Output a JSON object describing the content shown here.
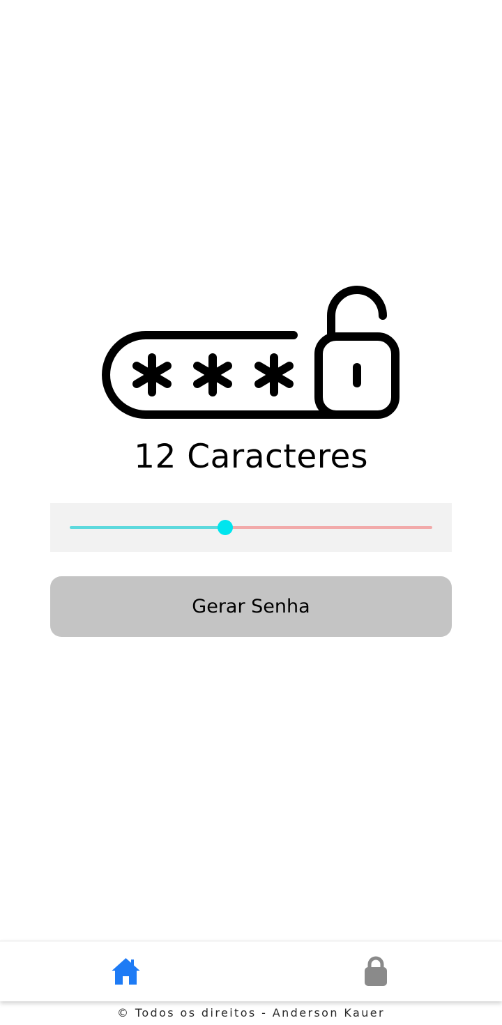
{
  "main": {
    "char_count_label": "12 Caracteres",
    "slider": {
      "value": 12,
      "min": 6,
      "max": 20,
      "fill_color": "#5dd9dd",
      "rest_color": "#f2aaaa",
      "thumb_color": "#00e5ee"
    },
    "generate_button_label": "Gerar Senha",
    "logo_icon": "password-unlock-icon"
  },
  "tabbar": {
    "home_icon": "home-icon",
    "home_color": "#1e7bf5",
    "lock_icon": "lock-icon",
    "lock_color": "#8a8a8a"
  },
  "footer": {
    "text": "© Todos os direitos - Anderson Kauer"
  }
}
